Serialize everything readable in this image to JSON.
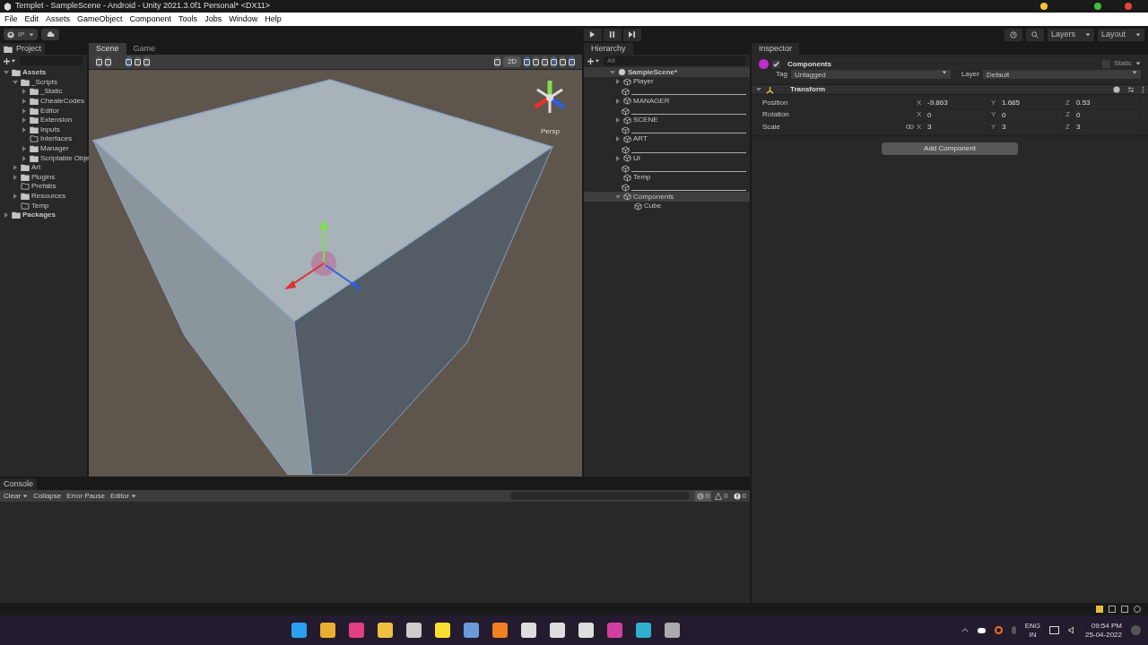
{
  "window": {
    "title": "Templet - SampleScene - Android - Unity 2021.3.0f1 Personal* <DX11>"
  },
  "menu": [
    "File",
    "Edit",
    "Assets",
    "GameObject",
    "Component",
    "Tools",
    "Jobs",
    "Window",
    "Help"
  ],
  "toolbar": {
    "account": "IP",
    "layers": "Layers",
    "layout": "Layout"
  },
  "project": {
    "tab": "Project",
    "tree": [
      {
        "name": "Assets",
        "expanded": true,
        "empty": false,
        "children": [
          {
            "name": "_Scripts",
            "expanded": true,
            "empty": false,
            "children": [
              {
                "name": "_Static",
                "expanded": false,
                "empty": false
              },
              {
                "name": "CheateCodes",
                "expanded": false,
                "empty": false
              },
              {
                "name": "Editor",
                "expanded": false,
                "empty": false
              },
              {
                "name": "Extension",
                "expanded": false,
                "empty": false
              },
              {
                "name": "Inputs",
                "expanded": false,
                "empty": false
              },
              {
                "name": "Interfaces",
                "expanded": false,
                "empty": true
              },
              {
                "name": "Manager",
                "expanded": false,
                "empty": false
              },
              {
                "name": "Scriptable Obje",
                "expanded": false,
                "empty": false
              }
            ]
          },
          {
            "name": "Art",
            "expanded": false,
            "empty": false
          },
          {
            "name": "Plugins",
            "expanded": false,
            "empty": false
          },
          {
            "name": "Prefabs",
            "expanded": false,
            "empty": true
          },
          {
            "name": "Resources",
            "expanded": false,
            "empty": false
          },
          {
            "name": "Temp",
            "expanded": false,
            "empty": true
          }
        ]
      },
      {
        "name": "Packages",
        "expanded": false,
        "empty": false
      }
    ]
  },
  "scene": {
    "tabs": [
      {
        "label": "Scene",
        "selected": true
      },
      {
        "label": "Game",
        "selected": false
      }
    ],
    "mode_2d": "2D",
    "projection": "Persp"
  },
  "hierarchy": {
    "tab": "Hierarchy",
    "search_placeholder": "All",
    "scene": "SampleScene*",
    "items": [
      {
        "kind": "object",
        "name": "Player",
        "expanded": false,
        "has_children": true,
        "selected": false
      },
      {
        "kind": "separator",
        "selected": false
      },
      {
        "kind": "object",
        "name": "MANAGER",
        "expanded": false,
        "has_children": true,
        "selected": false
      },
      {
        "kind": "separator",
        "selected": false
      },
      {
        "kind": "object",
        "name": "SCENE",
        "expanded": false,
        "has_children": true,
        "selected": false
      },
      {
        "kind": "separator",
        "selected": false
      },
      {
        "kind": "object",
        "name": "ART",
        "expanded": false,
        "has_children": true,
        "selected": false
      },
      {
        "kind": "separator",
        "selected": false
      },
      {
        "kind": "object",
        "name": "UI",
        "expanded": false,
        "has_children": true,
        "selected": false
      },
      {
        "kind": "separator",
        "selected": false
      },
      {
        "kind": "object",
        "name": "Temp",
        "expanded": false,
        "has_children": false,
        "selected": false
      },
      {
        "kind": "separator",
        "selected": false
      },
      {
        "kind": "object",
        "name": "Components",
        "expanded": true,
        "has_children": true,
        "selected": true,
        "children": [
          {
            "kind": "object",
            "name": "Cube",
            "expanded": false,
            "has_children": false,
            "selected": false
          }
        ]
      }
    ]
  },
  "inspector": {
    "tab": "Inspector",
    "object_name": "Components",
    "active": true,
    "static_label": "Static",
    "static": false,
    "tag_label": "Tag",
    "tag": "Untagged",
    "layer_label": "Layer",
    "layer": "Default",
    "component": {
      "name": "Transform",
      "expanded": true,
      "rows": [
        {
          "label": "Position",
          "linked": false,
          "fields": [
            {
              "axis": "X",
              "value": "-9.863"
            },
            {
              "axis": "Y",
              "value": "1.685"
            },
            {
              "axis": "Z",
              "value": "0.53"
            }
          ]
        },
        {
          "label": "Rotation",
          "linked": false,
          "fields": [
            {
              "axis": "X",
              "value": "0"
            },
            {
              "axis": "Y",
              "value": "0"
            },
            {
              "axis": "Z",
              "value": "0"
            }
          ]
        },
        {
          "label": "Scale",
          "linked": true,
          "fields": [
            {
              "axis": "X",
              "value": "3"
            },
            {
              "axis": "Y",
              "value": "3"
            },
            {
              "axis": "Z",
              "value": "3"
            }
          ]
        }
      ]
    },
    "add_button": "Add Component"
  },
  "console": {
    "tab": "Console",
    "buttons": [
      {
        "label": "Clear",
        "dropdown": true
      },
      {
        "label": "Collapse",
        "dropdown": false
      },
      {
        "label": "Error Pause",
        "dropdown": false
      },
      {
        "label": "Editor",
        "dropdown": true
      }
    ],
    "info_count": "0",
    "warning_count": "0",
    "error_count": "0"
  },
  "taskbar": {
    "language": "ENG",
    "region": "IN",
    "time": "09:54 PM",
    "date": "25-04-2022"
  }
}
